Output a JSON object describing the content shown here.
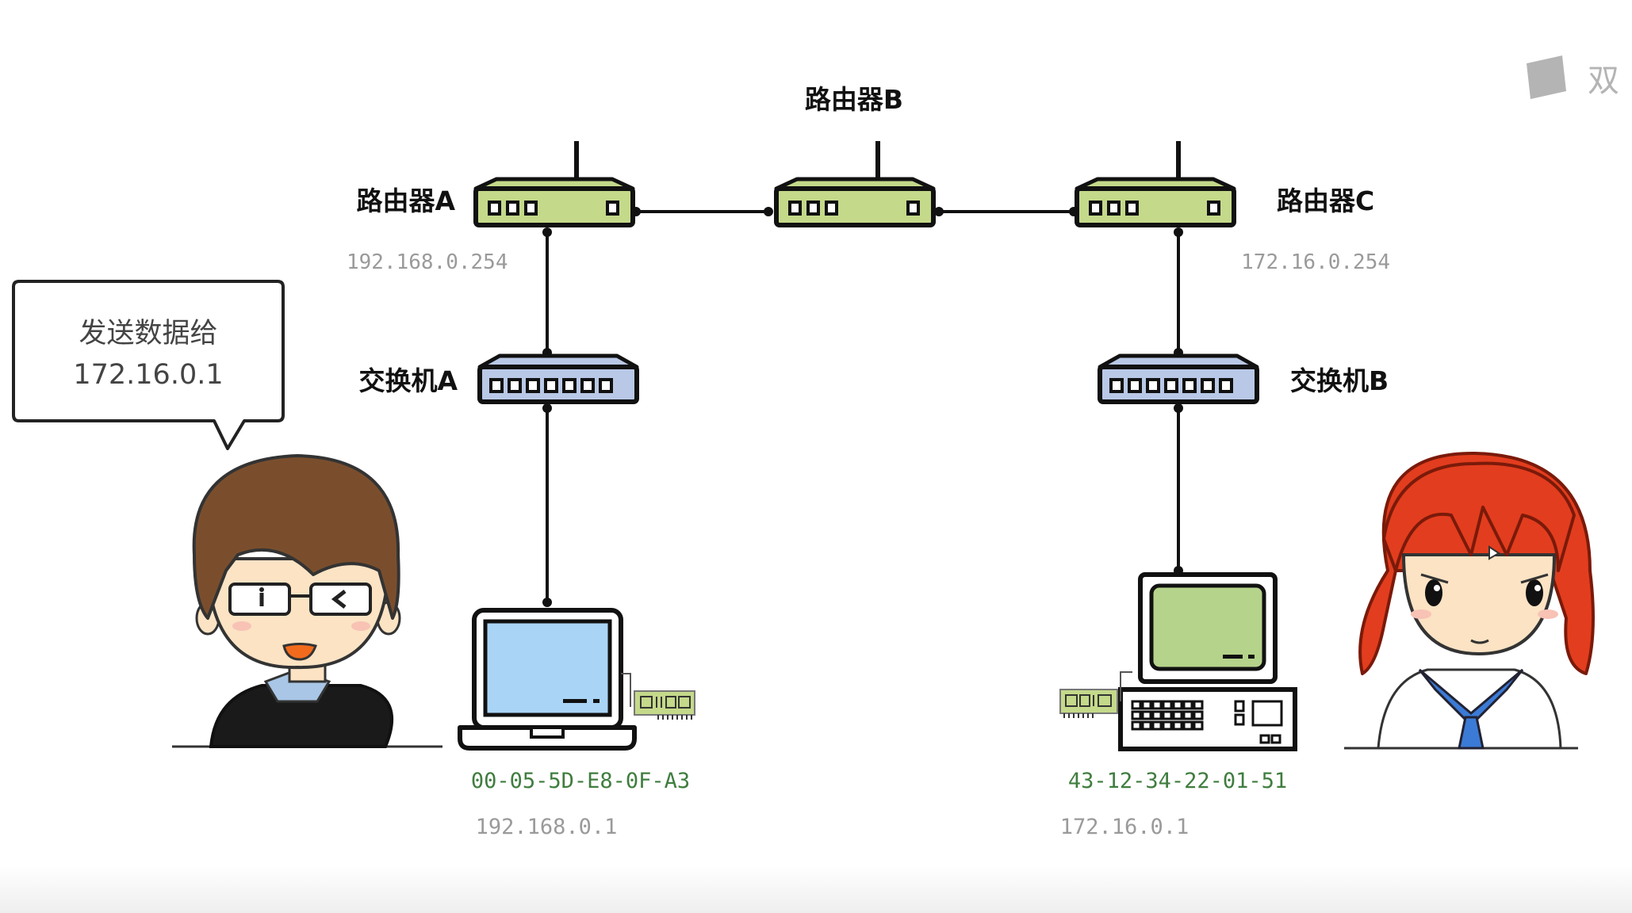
{
  "routers": {
    "a": {
      "label": "路由器A",
      "ip": "192.168.0.254"
    },
    "b": {
      "label": "路由器B"
    },
    "c": {
      "label": "路由器C",
      "ip": "172.16.0.254"
    }
  },
  "switches": {
    "a": {
      "label": "交换机A"
    },
    "b": {
      "label": "交换机B"
    }
  },
  "hosts": {
    "laptop": {
      "mac": "00-05-5D-E8-0F-A3",
      "ip": "192.168.0.1"
    },
    "desktop": {
      "mac": "43-12-34-22-01-51",
      "ip": "172.16.0.1"
    }
  },
  "speech": {
    "line1": "发送数据给",
    "line2": "172.16.0.1"
  },
  "watermark": {
    "text": "双"
  },
  "colors": {
    "router_fill": "#c4d98a",
    "switch_fill": "#b8c8e6",
    "laptop_screen": "#a9d4f5",
    "desktop_screen": "#b5d38a",
    "mac_text": "#3f7d3f",
    "ip_text": "#9a9a9a",
    "hair_boy": "#7a4e2d",
    "hair_girl": "#e23d1e"
  }
}
